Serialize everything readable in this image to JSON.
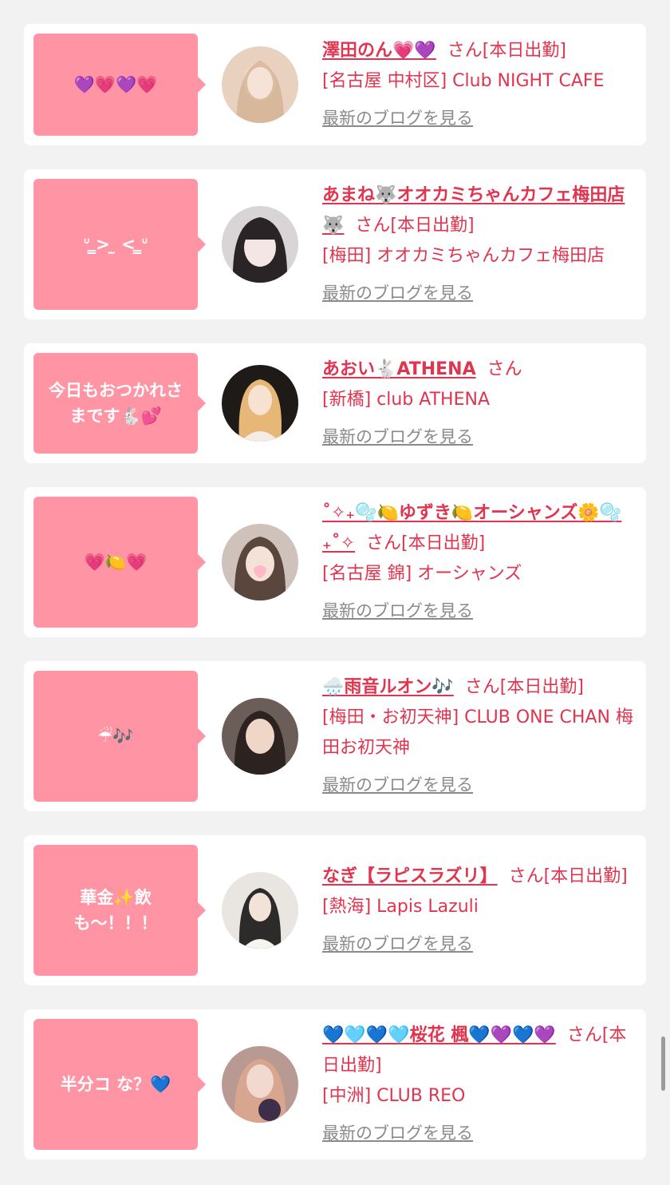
{
  "suffix_san": "さん",
  "blog_link_label": "最新のブログを見る",
  "colors": {
    "accent": "#e0344f",
    "bubble": "#ff94a4",
    "link_gray": "#8a8a8a"
  },
  "cards": [
    {
      "message": "💜💗💜💗",
      "name": "澤田のん💗💜",
      "suffix": "さん[本日出勤]",
      "shop": "[名古屋 中村区] Club NIGHT CAFE"
    },
    {
      "message": "ᐡ ̳> ̫ < ̳ᐡ",
      "name": "あまね🐺オオカミちゃんカフェ梅田店🐺",
      "suffix": "さん[本日出勤]",
      "shop": "[梅田] オオカミちゃんカフェ梅田店"
    },
    {
      "message": "今日もおつかれさ\nまです🐇💕",
      "name": "あおい🐇ATHENA",
      "suffix": "さん",
      "shop": "[新橋] club ATHENA"
    },
    {
      "message": "💗🍋💗",
      "name": "˚✧₊🫧🍋ゆずき🍋オーシャンズ🌼🫧₊˚✧",
      "suffix": "さん[本日出勤]",
      "shop": "[名古屋 錦] オーシャンズ"
    },
    {
      "message": "☔🎶",
      "name": "🌧️雨音ルオン🎶",
      "suffix": "さん[本日出勤]",
      "shop": "[梅田・お初天神] CLUB ONE CHAN 梅田お初天神"
    },
    {
      "message": "華金✨飲\nも〜！！！",
      "name": "なぎ【ラピスラズリ】",
      "suffix": "さん[本日出勤]",
      "shop": "[熱海] Lapis Lazuli"
    },
    {
      "message": "半分コ な？💙",
      "name": "💙🩵💙🩵桜花 楓💙💜💙💜",
      "suffix": "さん[本日出勤]",
      "shop": "[中洲] CLUB REO"
    }
  ]
}
